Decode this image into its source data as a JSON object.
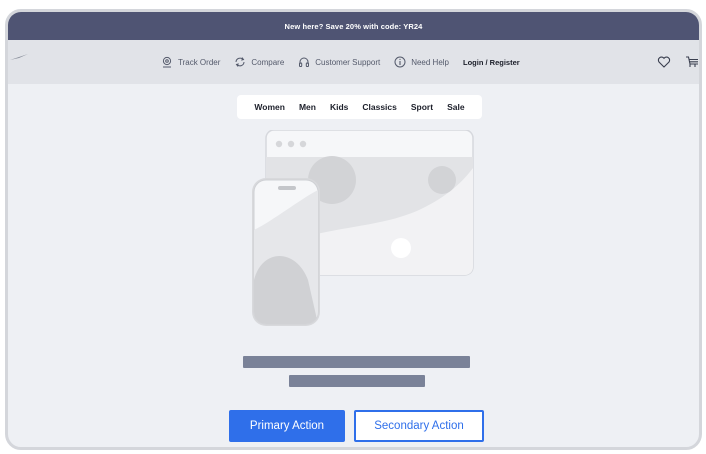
{
  "promo": {
    "text": "New here? Save 20% with code: YR24"
  },
  "nav": {
    "links": [
      {
        "label": "Track Order",
        "icon": "location-pin-icon"
      },
      {
        "label": "Compare",
        "icon": "compare-arrows-icon"
      },
      {
        "label": "Customer Support",
        "icon": "headphones-icon"
      },
      {
        "label": "Need Help",
        "icon": "info-icon"
      }
    ],
    "login_label": "Login / Register",
    "right_icons": [
      "heart-icon",
      "cart-icon"
    ]
  },
  "categories": [
    "Women",
    "Men",
    "Kids",
    "Classics",
    "Sport",
    "Sale"
  ],
  "actions": {
    "primary": "Primary Action",
    "secondary": "Secondary Action"
  },
  "colors": {
    "promo_bg": "#4f5473",
    "accent": "#2f6fea",
    "skeleton": "#7a8298"
  }
}
